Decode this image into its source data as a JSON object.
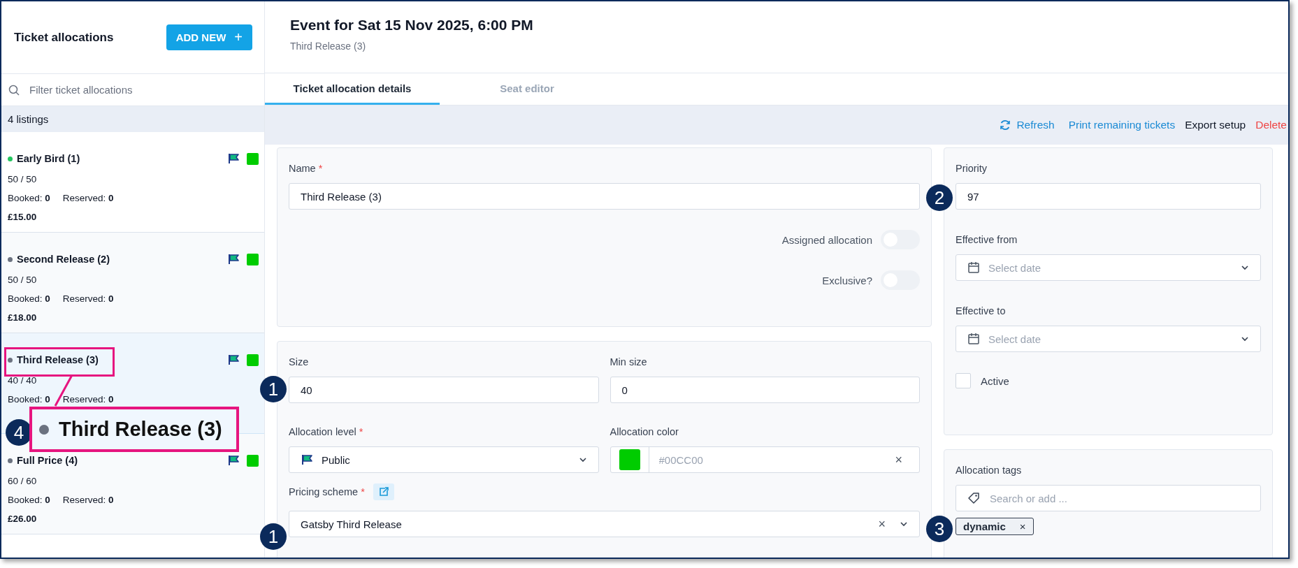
{
  "sidebar": {
    "title": "Ticket allocations",
    "add_button": "ADD NEW",
    "add_icon": "+",
    "filter_placeholder": "Filter ticket allocations",
    "count": "4 listings",
    "items": [
      {
        "name": "Early Bird (1)",
        "color": "#22c55e",
        "counts": "50 / 50",
        "booked": "Booked: **0**",
        "reserved": "Reserved: **0**",
        "price": "£15.00",
        "selected": false
      },
      {
        "name": "Second Release (2)",
        "color": "#6b7280",
        "counts": "50 / 50",
        "booked": "Booked: **0**",
        "reserved": "Reserved: **0**",
        "price": "£18.00",
        "selected": false
      },
      {
        "name": "Third Release (3)",
        "color": "#6b7280",
        "counts": "40 / 40",
        "booked": "Booked: **0**",
        "reserved": "Reserved: **0**",
        "selected": true
      },
      {
        "name": "Full Price (4)",
        "color": "#6b7280",
        "counts": "60 / 60",
        "booked": "Booked: **0**",
        "reserved": "Reserved: **0**",
        "price": "£26.00",
        "selected": false
      }
    ]
  },
  "header": {
    "title": "Event for Sat 15 Nov 2025, 6:00 PM",
    "subtitle": "Third Release (3)"
  },
  "tabs": [
    {
      "label": "Ticket allocation details",
      "selected": true
    },
    {
      "label": "Seat editor",
      "selected": false
    }
  ],
  "toolbar": [
    {
      "label": "Refresh",
      "kind": "refresh"
    },
    {
      "label": "Print remaining tickets",
      "kind": "link"
    },
    {
      "label": "Export setup",
      "kind": "plain"
    },
    {
      "label": "Delete",
      "kind": "danger"
    }
  ],
  "form": {
    "name": {
      "label": "Name",
      "required_mark": "*",
      "value": "Third Release (3)"
    },
    "toggles": [
      {
        "label": "Assigned allocation",
        "on": false
      },
      {
        "label": "Exclusive?",
        "on": false
      }
    ],
    "size": {
      "label": "Size",
      "value": "40"
    },
    "min_size": {
      "label": "Min size",
      "value": "0"
    },
    "allocation_level": {
      "label": "Allocation level",
      "required_mark": "*",
      "value": "Public"
    },
    "allocation_color": {
      "label": "Allocation color",
      "placeholder": "#00CC00",
      "color": "#00cc00",
      "clear": "×"
    },
    "pricing_scheme": {
      "label": "Pricing scheme",
      "required_mark": "*",
      "value": "Gatsby Third Release",
      "clear": "×"
    }
  },
  "side_form": {
    "priority": {
      "label": "Priority",
      "value": "97"
    },
    "effective_from": {
      "label": "Effective from",
      "placeholder": "Select date"
    },
    "effective_to": {
      "label": "Effective to",
      "placeholder": "Select date"
    },
    "active": {
      "label": "Active",
      "checked": false
    },
    "tags": {
      "label": "Allocation tags",
      "placeholder": "Search or add ...",
      "chips": [
        {
          "label": "dynamic",
          "remove": "×"
        }
      ]
    }
  },
  "annotations": {
    "callouts": [
      {
        "number": "1"
      },
      {
        "number": "2"
      },
      {
        "number": "3"
      },
      {
        "number": "1"
      },
      {
        "number": "4"
      }
    ],
    "magnifier": {
      "text": "Third Release (3)"
    }
  }
}
